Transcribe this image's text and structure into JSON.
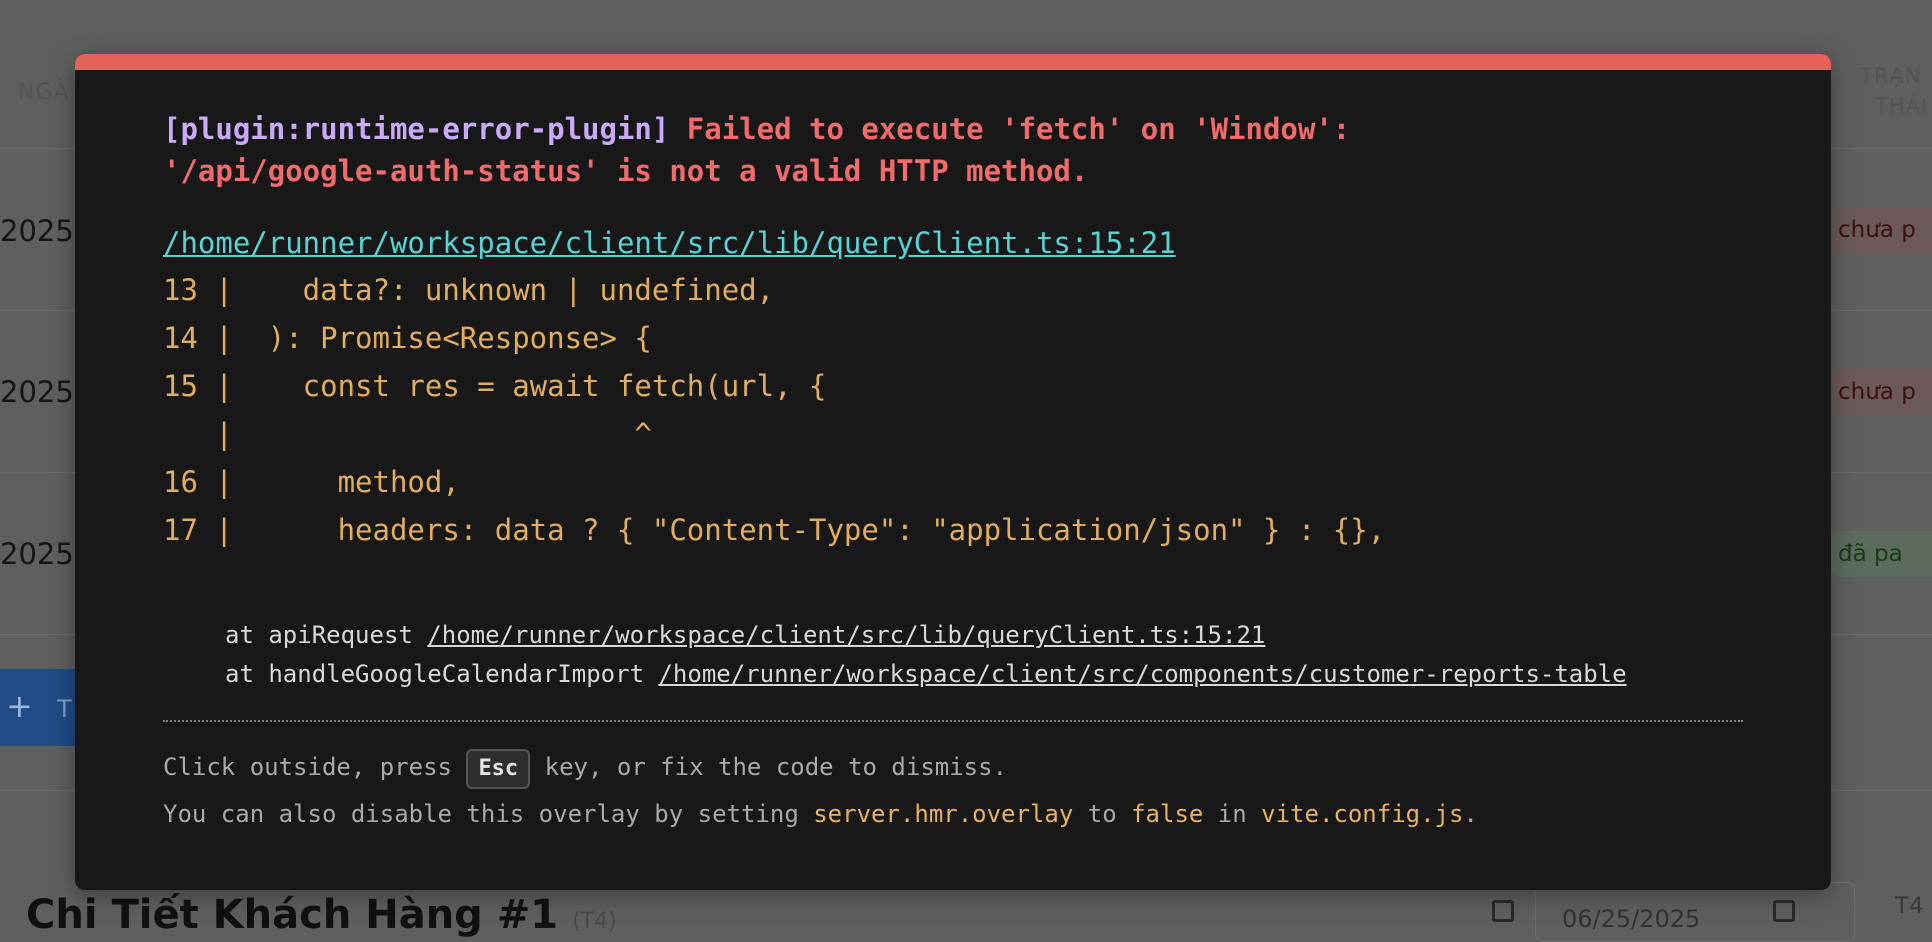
{
  "background": {
    "table_header": {
      "date_col": "NGÀ",
      "status_col_line1": "TRẠN",
      "status_col_line2": "THÁI"
    },
    "rows": [
      {
        "date": "2025-",
        "status": "chưa p"
      },
      {
        "date": "2025-",
        "status": "chưa p"
      },
      {
        "date": "2025-",
        "status": "đã pa"
      }
    ],
    "add_button": {
      "icon": "plus-icon",
      "glyph": "+",
      "label_fragment": "T"
    },
    "detail": {
      "title": "Chi Tiết Khách Hàng #1",
      "subtitle": "(T4)",
      "date_value": "06/25/2025",
      "right_fragment": "T4"
    }
  },
  "overlay": {
    "accent": "#e4625a",
    "plugin": "[plugin:runtime-error-plugin]",
    "message_line1": "Failed to execute 'fetch' on 'Window':",
    "message_line2": "'/api/google-auth-status' is not a valid HTTP method.",
    "file": "/home/runner/workspace/client/src/lib/queryClient.ts:15:21",
    "frame": [
      "13 |    data?: unknown | undefined,",
      "14 |  ): Promise<Response> {",
      "15 |    const res = await fetch(url, {",
      "   |                       ^",
      "16 |      method,",
      "17 |      headers: data ? { \"Content-Type\": \"application/json\" } : {},"
    ],
    "stack": [
      {
        "prefix": "at apiRequest ",
        "location": "/home/runner/workspace/client/src/lib/queryClient.ts:15:21"
      },
      {
        "prefix": "at handleGoogleCalendarImport ",
        "location": "/home/runner/workspace/client/src/components/customer-reports-table"
      }
    ],
    "tip1_before": "Click outside, press ",
    "tip1_key": "Esc",
    "tip1_after": " key, or fix the code to dismiss.",
    "tip2_a": "You can also disable this overlay by setting ",
    "tip2_code1": "server.hmr.overlay",
    "tip2_b": " to ",
    "tip2_code2": "false",
    "tip2_c": " in ",
    "tip2_code3": "vite.config.js",
    "tip2_d": "."
  }
}
